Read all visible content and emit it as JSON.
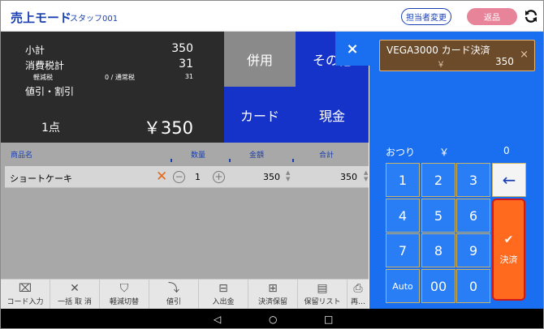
{
  "header": {
    "mode_title": "売上モード",
    "staff_name": "スタッフ001",
    "staff_change_label": "担当者変更",
    "return_label": "返品"
  },
  "summary": {
    "subtotal_label": "小計",
    "subtotal_value": "350",
    "tax_label": "消費税計",
    "tax_value": "31",
    "reduced_tax_label": "軽減税",
    "reduced_tax_detail": "0 / 通常税",
    "reduced_tax_value": "31",
    "discount_label": "値引・割引",
    "item_count": "1点",
    "total": "￥350"
  },
  "payment_buttons": {
    "heiyo": "併用",
    "sonota": "その他",
    "card": "カード",
    "cash": "現金"
  },
  "list": {
    "headers": {
      "name": "商品名",
      "qty": "数量",
      "price": "金額",
      "total": "合計"
    },
    "rows": [
      {
        "name": "ショートケーキ",
        "qty": "1",
        "price": "350",
        "total": "350"
      }
    ]
  },
  "toolbar": [
    {
      "icon": "barcode-icon",
      "label": "コード入力"
    },
    {
      "icon": "x-icon",
      "label": "一括 取 消"
    },
    {
      "icon": "tax-switch-icon",
      "label": "軽減切替"
    },
    {
      "icon": "discount-icon",
      "label": "値引"
    },
    {
      "icon": "cash-drawer-icon",
      "label": "入出金"
    },
    {
      "icon": "basket-icon",
      "label": "決済保留"
    },
    {
      "icon": "hold-list-icon",
      "label": "保留リスト"
    },
    {
      "icon": "reprint-icon",
      "label": "再…"
    }
  ],
  "nav": {
    "back": "◁",
    "home": "○",
    "recent": "□"
  },
  "pay_panel": {
    "close_symbol": "×",
    "chip_title": "VEGA3000 カード決済",
    "chip_yen": "￥",
    "chip_amount": "350",
    "chip_close": "×",
    "change_label": "おつり",
    "change_yen": "￥",
    "change_value": "0",
    "keys": [
      "1",
      "2",
      "3",
      "4",
      "5",
      "6",
      "7",
      "8",
      "9",
      "Auto",
      "00",
      "0"
    ],
    "backspace_symbol": "←",
    "settle_check": "✔",
    "settle_label": "決済"
  },
  "colors": {
    "accent_blue": "#1533c8",
    "panel_blue": "#1a6ff0",
    "settle_orange": "#ff6a1f",
    "return_pink": "#e8849a"
  }
}
